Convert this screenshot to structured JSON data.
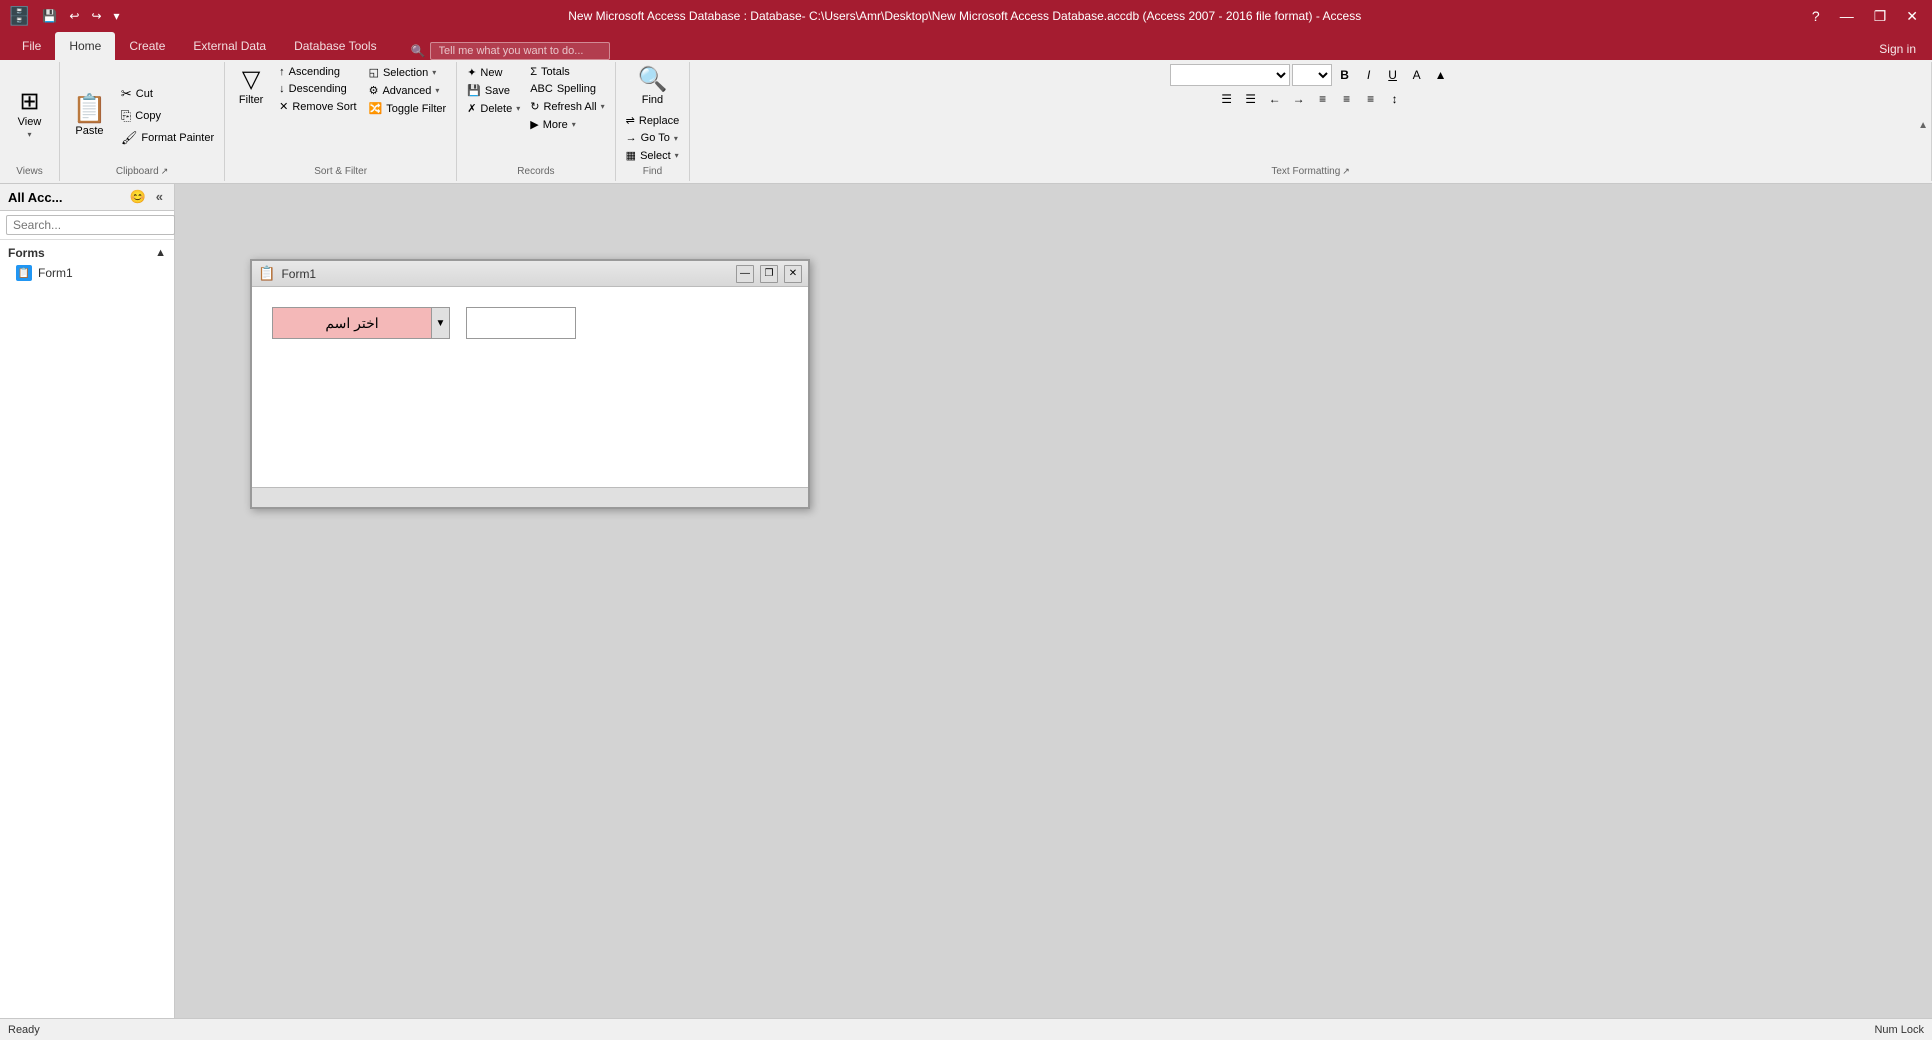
{
  "titlebar": {
    "title": "New Microsoft Access Database : Database- C:\\Users\\Amr\\Desktop\\New Microsoft Access Database.accdb (Access 2007 - 2016 file format) - Access",
    "qat": [
      "save",
      "undo",
      "redo",
      "customize"
    ],
    "win_btns": [
      "?",
      "—",
      "❐",
      "✕"
    ]
  },
  "ribbon": {
    "tabs": [
      "File",
      "Home",
      "Create",
      "External Data",
      "Database Tools"
    ],
    "active_tab": "Home",
    "search_placeholder": "Tell me what you want to do...",
    "sign_in": "Sign in",
    "groups": {
      "views": {
        "label": "Views",
        "view_btn": "View"
      },
      "clipboard": {
        "label": "Clipboard",
        "paste": "Paste",
        "cut": "Cut",
        "copy": "Copy",
        "format_painter": "Format Painter"
      },
      "sort_filter": {
        "label": "Sort & Filter",
        "filter": "Filter",
        "ascending": "Ascending",
        "descending": "Descending",
        "remove_sort": "Remove Sort",
        "selection": "Selection",
        "advanced": "Advanced",
        "toggle_filter": "Toggle Filter"
      },
      "records": {
        "label": "Records",
        "new": "New",
        "save": "Save",
        "delete": "Delete",
        "totals": "Totals",
        "spelling": "Spelling",
        "refresh_all": "Refresh All",
        "more": "More"
      },
      "find": {
        "label": "Find",
        "find": "Find",
        "replace": "Replace",
        "goto": "Go To",
        "select": "Select"
      },
      "text_formatting": {
        "label": "Text Formatting",
        "font_name": "",
        "font_size": "",
        "bold": "B",
        "italic": "I",
        "underline": "U",
        "font_color": "A",
        "highlight": "▲",
        "bullet_list": "☰",
        "numbered_list": "☰",
        "indent_dec": "←",
        "indent_inc": "→",
        "align_left": "≡",
        "align_center": "≡",
        "align_right": "≡",
        "line_spacing": "↕"
      }
    }
  },
  "sidebar": {
    "title": "All Acc...",
    "icons": [
      "😊",
      "«"
    ],
    "search_placeholder": "Search...",
    "sections": [
      {
        "name": "Forms",
        "items": [
          {
            "name": "Form1",
            "icon": "📋"
          }
        ]
      }
    ]
  },
  "form_window": {
    "title": "Form1",
    "icon": "📋",
    "combo_label": "اختر اسم",
    "textbox_value": ""
  },
  "status": {
    "ready": "Ready",
    "num_lock": "Num Lock"
  }
}
